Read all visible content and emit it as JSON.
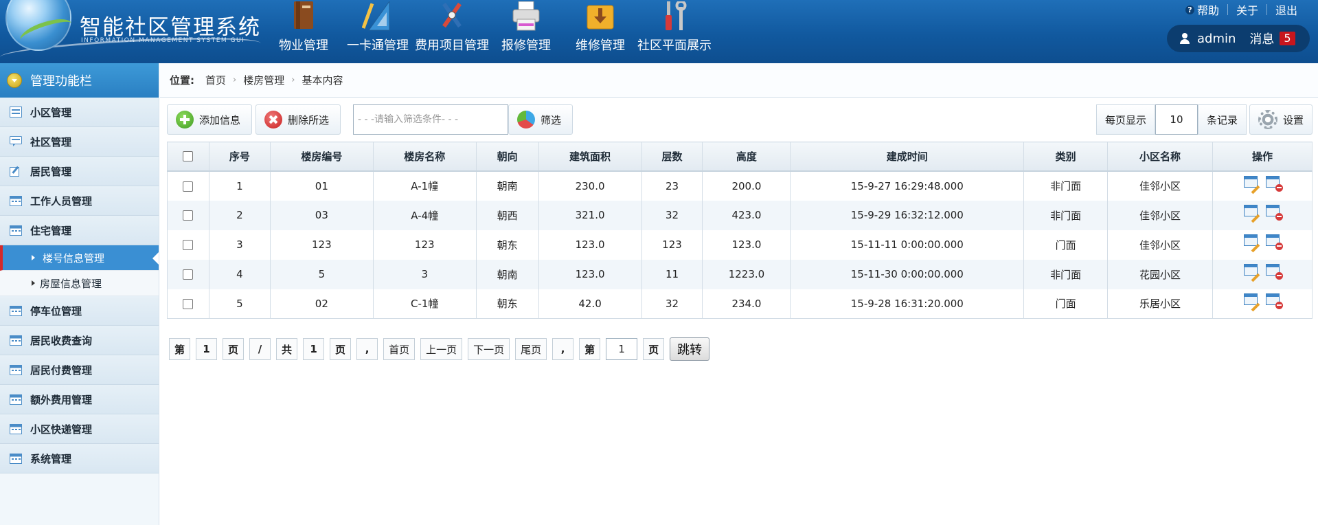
{
  "app": {
    "title": "智能社区管理系统",
    "subtitle": "INFORMATION MANAGEMENT SYSTEM GUI"
  },
  "topnav": [
    {
      "label": "物业管理",
      "icon": "book-icon"
    },
    {
      "label": "一卡通管理",
      "icon": "ruler-triangle-icon"
    },
    {
      "label": "费用项目管理",
      "icon": "pen-tools-icon"
    },
    {
      "label": "报修管理",
      "icon": "printer-icon"
    },
    {
      "label": "维修管理",
      "icon": "download-box-icon"
    },
    {
      "label": "社区平面展示",
      "icon": "wrench-screwdriver-icon"
    }
  ],
  "toplinks": {
    "help": "帮助",
    "about": "关于",
    "logout": "退出"
  },
  "user": {
    "name": "admin",
    "messages_label": "消息",
    "messages_count": "5"
  },
  "sidebar": {
    "header": "管理功能栏",
    "items": [
      {
        "label": "小区管理"
      },
      {
        "label": "社区管理"
      },
      {
        "label": "居民管理"
      },
      {
        "label": "工作人员管理"
      },
      {
        "label": "住宅管理"
      }
    ],
    "subitems": [
      {
        "label": "楼号信息管理",
        "active": true
      },
      {
        "label": "房屋信息管理",
        "active": false
      }
    ],
    "items_after": [
      {
        "label": "停车位管理"
      },
      {
        "label": "居民收费查询"
      },
      {
        "label": "居民付费管理"
      },
      {
        "label": "额外费用管理"
      },
      {
        "label": "小区快递管理"
      },
      {
        "label": "系统管理"
      }
    ]
  },
  "breadcrumb": {
    "label": "位置:",
    "items": [
      "首页",
      "楼房管理",
      "基本内容"
    ]
  },
  "toolbar": {
    "add_label": "添加信息",
    "delete_label": "删除所选",
    "filter_placeholder": "- - -请输入筛选条件- - -",
    "filter_label": "筛选",
    "per_page_label": "每页显示",
    "per_page_value": "10",
    "records_label": "条记录",
    "settings_label": "设置"
  },
  "table": {
    "columns": [
      "序号",
      "楼房编号",
      "楼房名称",
      "朝向",
      "建筑面积",
      "层数",
      "高度",
      "建成时间",
      "类别",
      "小区名称",
      "操作"
    ],
    "rows": [
      [
        "1",
        "01",
        "A-1幢",
        "朝南",
        "230.0",
        "23",
        "200.0",
        "15-9-27 16:29:48.000",
        "非门面",
        "佳邻小区"
      ],
      [
        "2",
        "03",
        "A-4幢",
        "朝西",
        "321.0",
        "32",
        "423.0",
        "15-9-29 16:32:12.000",
        "非门面",
        "佳邻小区"
      ],
      [
        "3",
        "123",
        "123",
        "朝东",
        "123.0",
        "123",
        "123.0",
        "15-11-11 0:00:00.000",
        "门面",
        "佳邻小区"
      ],
      [
        "4",
        "5",
        "3",
        "朝南",
        "123.0",
        "11",
        "1223.0",
        "15-11-30 0:00:00.000",
        "非门面",
        "花园小区"
      ],
      [
        "5",
        "02",
        "C-1幢",
        "朝东",
        "42.0",
        "32",
        "234.0",
        "15-9-28 16:31:20.000",
        "门面",
        "乐居小区"
      ]
    ]
  },
  "pager": {
    "di": "第",
    "current": "1",
    "ye": "页",
    "slash": "/",
    "gong": "共",
    "total": "1",
    "ye2": "页",
    "comma": ",",
    "first": "首页",
    "prev": "上一页",
    "next": "下一页",
    "last": "尾页",
    "comma2": ",",
    "di2": "第",
    "jump_value": "1",
    "ye3": "页",
    "go": "跳转"
  }
}
